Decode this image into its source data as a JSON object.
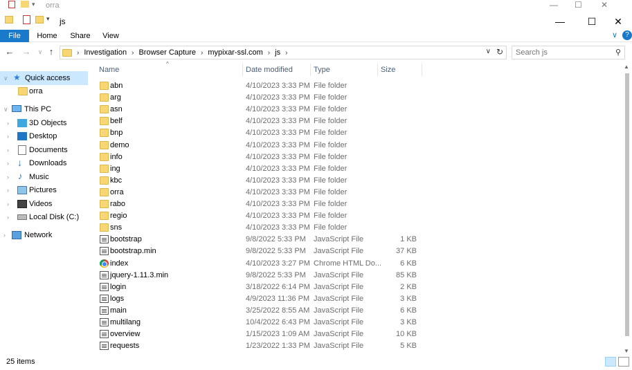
{
  "ghost": {
    "title": "orra"
  },
  "window": {
    "title": "js",
    "minimize": "—",
    "maximize": "☐",
    "close": "✕"
  },
  "ribbon": {
    "tabs": [
      "File",
      "Home",
      "Share",
      "View"
    ]
  },
  "address": {
    "crumbs": [
      "Investigation",
      "Browser Capture",
      "mypixar-ssl.com",
      "js"
    ],
    "search_placeholder": "Search js"
  },
  "nav": {
    "items": [
      {
        "label": "Quick access",
        "icon": "star-icon"
      },
      {
        "label": "orra",
        "icon": "folder-icon"
      },
      {
        "label": "This PC",
        "icon": "computer-icon"
      },
      {
        "label": "3D Objects",
        "icon": "cube-icon"
      },
      {
        "label": "Desktop",
        "icon": "desktop-icon"
      },
      {
        "label": "Documents",
        "icon": "documents-icon"
      },
      {
        "label": "Downloads",
        "icon": "download-icon"
      },
      {
        "label": "Music",
        "icon": "music-icon"
      },
      {
        "label": "Pictures",
        "icon": "pictures-icon"
      },
      {
        "label": "Videos",
        "icon": "videos-icon"
      },
      {
        "label": "Local Disk (C:)",
        "icon": "disk-icon"
      },
      {
        "label": "Network",
        "icon": "network-icon"
      }
    ]
  },
  "columns": {
    "name": "Name",
    "date": "Date modified",
    "type": "Type",
    "size": "Size"
  },
  "files": [
    {
      "name": "abn",
      "date": "4/10/2023 3:33 PM",
      "type": "File folder",
      "size": "",
      "kind": "folder"
    },
    {
      "name": "arg",
      "date": "4/10/2023 3:33 PM",
      "type": "File folder",
      "size": "",
      "kind": "folder"
    },
    {
      "name": "asn",
      "date": "4/10/2023 3:33 PM",
      "type": "File folder",
      "size": "",
      "kind": "folder"
    },
    {
      "name": "belf",
      "date": "4/10/2023 3:33 PM",
      "type": "File folder",
      "size": "",
      "kind": "folder"
    },
    {
      "name": "bnp",
      "date": "4/10/2023 3:33 PM",
      "type": "File folder",
      "size": "",
      "kind": "folder"
    },
    {
      "name": "demo",
      "date": "4/10/2023 3:33 PM",
      "type": "File folder",
      "size": "",
      "kind": "folder"
    },
    {
      "name": "info",
      "date": "4/10/2023 3:33 PM",
      "type": "File folder",
      "size": "",
      "kind": "folder"
    },
    {
      "name": "ing",
      "date": "4/10/2023 3:33 PM",
      "type": "File folder",
      "size": "",
      "kind": "folder"
    },
    {
      "name": "kbc",
      "date": "4/10/2023 3:33 PM",
      "type": "File folder",
      "size": "",
      "kind": "folder"
    },
    {
      "name": "orra",
      "date": "4/10/2023 3:33 PM",
      "type": "File folder",
      "size": "",
      "kind": "folder"
    },
    {
      "name": "rabo",
      "date": "4/10/2023 3:33 PM",
      "type": "File folder",
      "size": "",
      "kind": "folder"
    },
    {
      "name": "regio",
      "date": "4/10/2023 3:33 PM",
      "type": "File folder",
      "size": "",
      "kind": "folder"
    },
    {
      "name": "sns",
      "date": "4/10/2023 3:33 PM",
      "type": "File folder",
      "size": "",
      "kind": "folder"
    },
    {
      "name": "bootstrap",
      "date": "9/8/2022 5:33 PM",
      "type": "JavaScript File",
      "size": "1 KB",
      "kind": "js"
    },
    {
      "name": "bootstrap.min",
      "date": "9/8/2022 5:33 PM",
      "type": "JavaScript File",
      "size": "37 KB",
      "kind": "js"
    },
    {
      "name": "index",
      "date": "4/10/2023 3:27 PM",
      "type": "Chrome HTML Do...",
      "size": "6 KB",
      "kind": "chrome"
    },
    {
      "name": "jquery-1.11.3.min",
      "date": "9/8/2022 5:33 PM",
      "type": "JavaScript File",
      "size": "85 KB",
      "kind": "js"
    },
    {
      "name": "login",
      "date": "3/18/2022 6:14 PM",
      "type": "JavaScript File",
      "size": "2 KB",
      "kind": "js"
    },
    {
      "name": "logs",
      "date": "4/9/2023 11:36 PM",
      "type": "JavaScript File",
      "size": "3 KB",
      "kind": "js"
    },
    {
      "name": "main",
      "date": "3/25/2022 8:55 AM",
      "type": "JavaScript File",
      "size": "6 KB",
      "kind": "js"
    },
    {
      "name": "multilang",
      "date": "10/4/2022 6:43 PM",
      "type": "JavaScript File",
      "size": "3 KB",
      "kind": "js"
    },
    {
      "name": "overview",
      "date": "1/15/2023 1:09 AM",
      "type": "JavaScript File",
      "size": "10 KB",
      "kind": "js"
    },
    {
      "name": "requests",
      "date": "1/23/2022 1:33 PM",
      "type": "JavaScript File",
      "size": "5 KB",
      "kind": "js"
    }
  ],
  "status": {
    "count": "25 items"
  },
  "colors": {
    "accent": "#1979ca",
    "selection": "#cce8ff",
    "folder": "#f7d774"
  }
}
